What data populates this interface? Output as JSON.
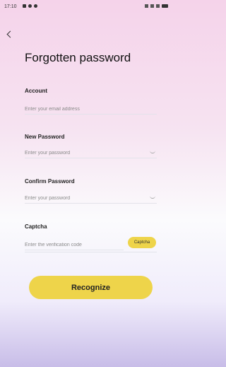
{
  "status_bar": {
    "time": "17:10"
  },
  "page": {
    "title": "Forgotten password"
  },
  "form": {
    "account": {
      "label": "Account",
      "placeholder": "Enter your email address"
    },
    "new_password": {
      "label": "New Password",
      "placeholder": "Enter your password"
    },
    "confirm_password": {
      "label": "Confirm Password",
      "placeholder": "Enter your password"
    },
    "captcha": {
      "label": "Captcha",
      "placeholder": "Enter the verification code",
      "button_label": "Captcha"
    }
  },
  "actions": {
    "recognize_label": "Recognize"
  },
  "icons": [
    "back-arrow-icon",
    "eye-closed-icon"
  ],
  "colors": {
    "accent": "#eed44a"
  }
}
